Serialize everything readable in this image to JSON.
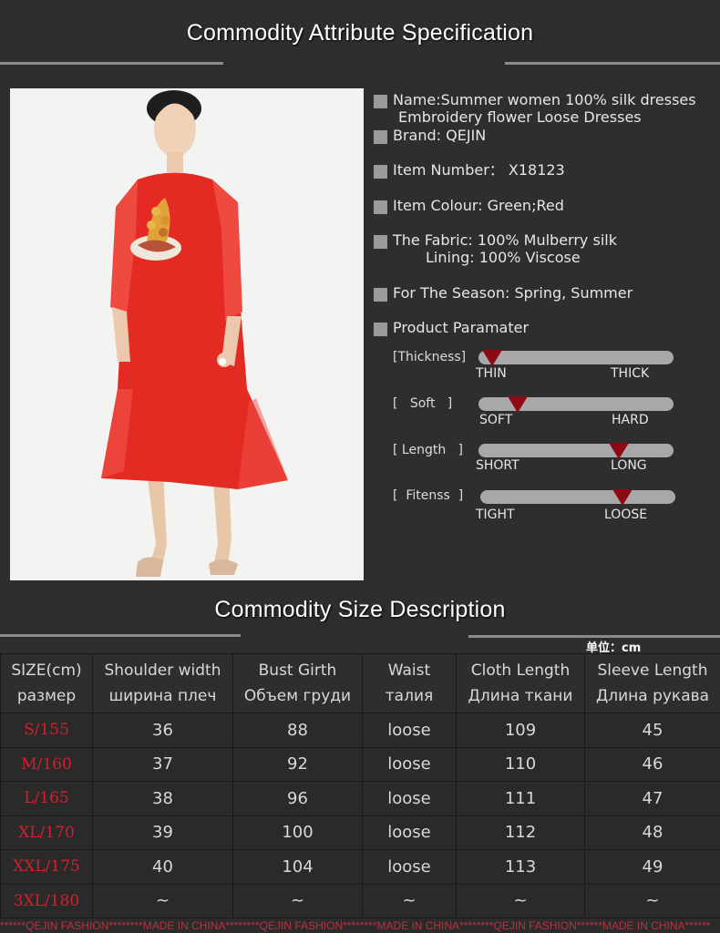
{
  "attribute_section": {
    "title": "Commodity Attribute Specification"
  },
  "product": {
    "name_line1": "Name:Summer women 100% silk dresses",
    "name_line2": "Embroidery flower Loose Dresses",
    "brand": "Brand: QEJIN",
    "item_number": "Item Number： X18123",
    "colour": "Item Colour: Green;Red",
    "fabric": "The Fabric:  100% Mulberry silk",
    "lining": "Lining:  100% Viscose",
    "season": "For The Season:  Spring, Summer",
    "parameter_heading": "Product Paramater"
  },
  "parameters": [
    {
      "label": "[Thickness]",
      "low": "THIN",
      "high": "THICK",
      "level": 0.07
    },
    {
      "label": "[   Soft   ]",
      "low": "SOFT",
      "high": "HARD",
      "level": 0.2
    },
    {
      "label": "[ Length   ]",
      "low": "SHORT",
      "high": "LONG",
      "level": 0.72
    },
    {
      "label": "[  Fitenss  ]",
      "low": "TIGHT",
      "high": "LOOSE",
      "level": 0.73
    }
  ],
  "size_section": {
    "title": "Commodity Size Description",
    "unit": "单位：cm"
  },
  "size_table": {
    "headers": [
      {
        "en": "SIZE(cm)",
        "ru": "размер"
      },
      {
        "en": "Shoulder width",
        "ru": "ширина плеч"
      },
      {
        "en": "Bust Girth",
        "ru": "Объем груди"
      },
      {
        "en": "Waist",
        "ru": "талия"
      },
      {
        "en": "Cloth Length",
        "ru": "Длина ткани"
      },
      {
        "en": "Sleeve Length",
        "ru": "Длина рукава"
      }
    ],
    "rows": [
      [
        "S/155",
        "36",
        "88",
        "loose",
        "109",
        "45"
      ],
      [
        "M/160",
        "37",
        "92",
        "loose",
        "110",
        "46"
      ],
      [
        "L/165",
        "38",
        "96",
        "loose",
        "111",
        "47"
      ],
      [
        "XL/170",
        "39",
        "100",
        "loose",
        "112",
        "48"
      ],
      [
        "XXL/175",
        "40",
        "104",
        "loose",
        "113",
        "49"
      ],
      [
        "3XL/180",
        "~",
        "~",
        "~",
        "~",
        "~"
      ]
    ]
  },
  "footer": "******QEJIN FASHION********MADE IN CHINA********QEJIN FASHION********MADE IN CHINA********QEJIN FASHION******MADE IN CHINA******",
  "colors": {
    "background": "#2e2e2e",
    "size_label": "#d4202c",
    "marker": "#8b0a14",
    "dress": "#e32a23"
  }
}
